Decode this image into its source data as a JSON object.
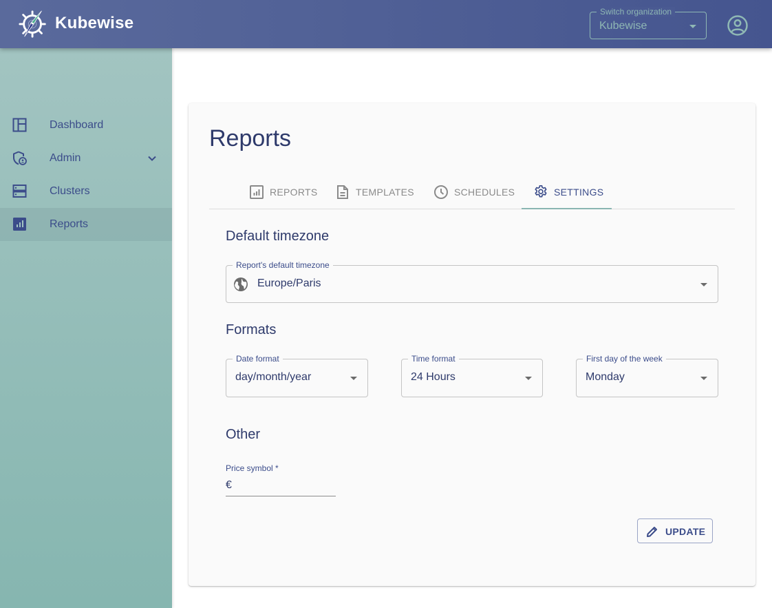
{
  "header": {
    "brand_name": "Kubewise",
    "org_switch": {
      "label": "Switch organization",
      "value": "Kubewise"
    },
    "account_icon": "account-circle-icon"
  },
  "sidebar": {
    "items": [
      {
        "label": "Dashboard",
        "icon": "dashboard-icon",
        "active": false
      },
      {
        "label": "Admin",
        "icon": "admin-shield-icon",
        "active": false,
        "expandable": true
      },
      {
        "label": "Clusters",
        "icon": "clusters-icon",
        "active": false
      },
      {
        "label": "Reports",
        "icon": "reports-icon",
        "active": true
      }
    ]
  },
  "main": {
    "title": "Reports",
    "tabs": [
      {
        "label": "REPORTS",
        "icon": "report-chart-icon",
        "active": false
      },
      {
        "label": "TEMPLATES",
        "icon": "document-icon",
        "active": false
      },
      {
        "label": "SCHEDULES",
        "icon": "clock-icon",
        "active": false
      },
      {
        "label": "SETTINGS",
        "icon": "gear-icon",
        "active": true
      }
    ],
    "timezone_section": {
      "title": "Default timezone",
      "field": {
        "label": "Report's default timezone",
        "value": "Europe/Paris",
        "icon": "globe-icon"
      }
    },
    "formats_section": {
      "title": "Formats",
      "date_format": {
        "label": "Date format",
        "value": "day/month/year"
      },
      "time_format": {
        "label": "Time format",
        "value": "24 Hours"
      },
      "first_day": {
        "label": "First day of the week",
        "value": "Monday"
      }
    },
    "other_section": {
      "title": "Other",
      "price_symbol": {
        "label": "Price symbol *",
        "value": "€"
      }
    },
    "update_button": {
      "label": "UPDATE",
      "icon": "pencil-icon"
    }
  },
  "colors": {
    "header_bg": "#4f5f96",
    "sidebar_bg": "#a2c4c1",
    "primary_text": "#2e3a6b",
    "accent": "#3b4c8a",
    "tab_indicator": "#8ab5b1"
  }
}
